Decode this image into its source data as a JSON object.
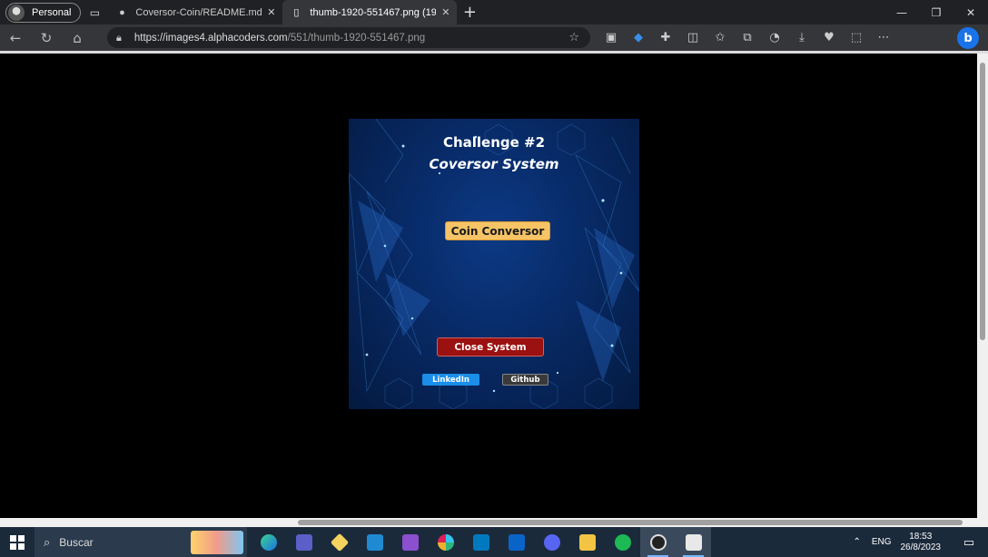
{
  "browser": {
    "profile_label": "Personal",
    "tabs": [
      {
        "title": "Coversor-Coin/README.md at m",
        "icon": "github-icon"
      },
      {
        "title": "thumb-1920-551467.png (1920",
        "icon": "page-icon"
      }
    ],
    "url_host": "https://images4.alphacoders.com",
    "url_path": "/551/thumb-1920-551467.png"
  },
  "app": {
    "title": "Challenge #2",
    "subtitle": "Coversor System",
    "coin_button": "Coin Conversor",
    "close_button": "Close System",
    "linkedin_button": "LinkedIn",
    "github_button": "Github",
    "colors": {
      "coin": "#f6c467",
      "close": "#9b1010",
      "linkedin": "#1a8ee8",
      "github": "#3a3a3a"
    }
  },
  "taskbar": {
    "search_placeholder": "Buscar",
    "language": "ENG",
    "time": "18:53",
    "date": "26/8/2023"
  }
}
